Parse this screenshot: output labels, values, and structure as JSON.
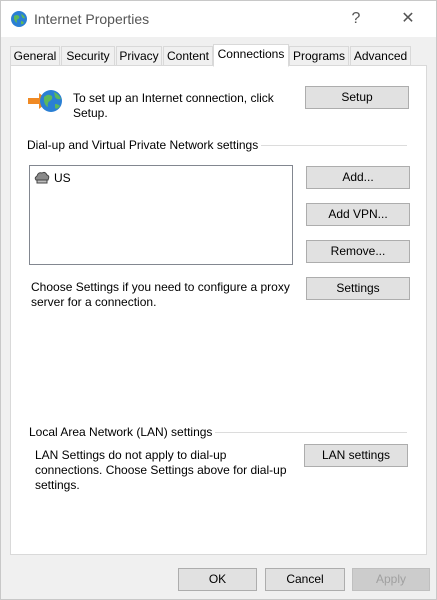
{
  "window": {
    "title": "Internet Properties",
    "help_glyph": "?",
    "close_glyph": "✕"
  },
  "tabs": [
    {
      "label": "General"
    },
    {
      "label": "Security"
    },
    {
      "label": "Privacy"
    },
    {
      "label": "Content"
    },
    {
      "label": "Connections",
      "active": true
    },
    {
      "label": "Programs"
    },
    {
      "label": "Advanced"
    }
  ],
  "setup": {
    "description": "To set up an Internet connection, click Setup.",
    "button_label": "Setup"
  },
  "dialup": {
    "group_label": "Dial-up and Virtual Private Network settings",
    "items": [
      {
        "label": "US"
      }
    ],
    "add_label": "Add...",
    "add_vpn_label": "Add VPN...",
    "remove_label": "Remove...",
    "settings_label": "Settings",
    "proxy_text": "Choose Settings if you need to configure a proxy server for a connection."
  },
  "lan": {
    "group_label": "Local Area Network (LAN) settings",
    "description": "LAN Settings do not apply to dial-up connections. Choose Settings above for dial-up settings.",
    "button_label": "LAN settings"
  },
  "footer": {
    "ok_label": "OK",
    "cancel_label": "Cancel",
    "apply_label": "Apply",
    "apply_disabled": true
  },
  "colors": {
    "window_bg": "#f0f0f0",
    "panel_bg": "#ffffff",
    "button_bg": "#e1e1e1",
    "button_border": "#adadad",
    "globe_blue": "#2a7fd4",
    "arrow_orange": "#f08a24"
  }
}
